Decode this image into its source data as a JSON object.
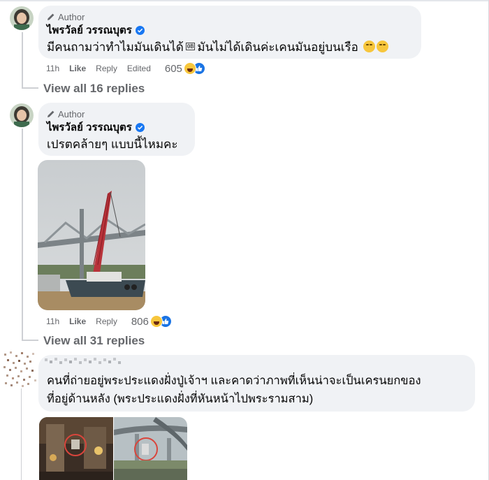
{
  "comments": [
    {
      "author_badge": "Author",
      "name": "ไพรวัลย์ วรรณบุตร",
      "text_before": "มีคนถามว่าทำไมมันเดินได้",
      "inline_box": "0B",
      "text_after": "มันไม่ได้เดินค่ะเคนมันอยู่บนเรือ",
      "time": "11h",
      "like": "Like",
      "reply": "Reply",
      "edited": "Edited",
      "reaction_count": "605",
      "view_replies": "View all 16 replies"
    },
    {
      "author_badge": "Author",
      "name": "ไพรวัลย์ วรรณบุตร",
      "text": "เปรตคล้ายๆ แบบนี้ไหมคะ",
      "time": "11h",
      "like": "Like",
      "reply": "Reply",
      "reaction_count": "806",
      "view_replies": "View all 31 replies"
    },
    {
      "text_line1": "คนที่ถ่ายอยู่พระประแดงฝั่งปู่เจ้าฯ และคาดว่าภาพที่เห็นน่าจะเป็นเครนยกของ",
      "text_line2": "ที่อยู่ด้านหลัง (พระประแดงฝั่งที่หันหน้าไปพระรามสาม)"
    }
  ],
  "icons": {
    "author_badge": "pencil-icon",
    "verified": "verified-badge-icon",
    "reactions": [
      "haha-reaction-icon",
      "like-reaction-icon"
    ],
    "emoji": "rolling-eyes-emoji"
  },
  "colors": {
    "bubble": "#f0f2f5",
    "secondary_text": "#65676b",
    "verified_blue": "#1877f2"
  }
}
